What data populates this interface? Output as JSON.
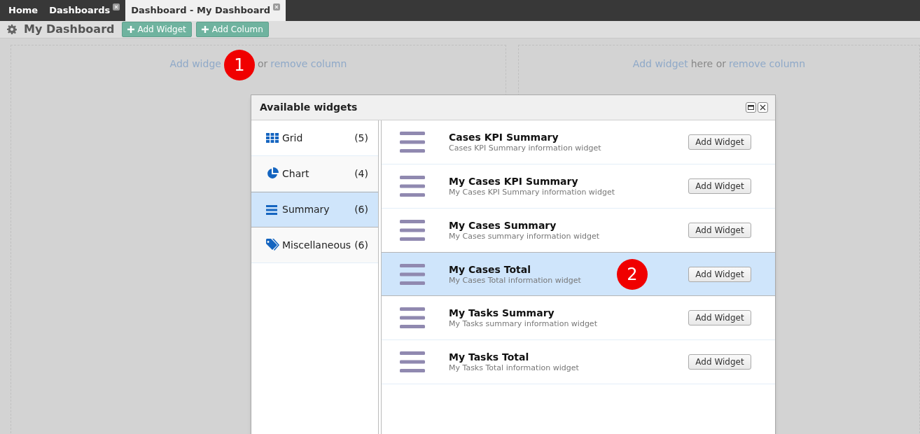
{
  "tabs": [
    {
      "label": "Home",
      "selected": false,
      "closable": false
    },
    {
      "label": "Dashboards",
      "selected": false,
      "closable": true
    },
    {
      "label": "Dashboard - My Dashboard",
      "selected": true,
      "closable": true
    }
  ],
  "toolbar": {
    "title": "My Dashboard",
    "buttons": [
      "Add Widget",
      "Add Column"
    ]
  },
  "columns": [
    {
      "segments": [
        {
          "kind": "link",
          "text": "Add widge"
        },
        {
          "kind": "callout",
          "text": "1"
        },
        {
          "kind": "text",
          "text": "or"
        },
        {
          "kind": "link",
          "text": "remove column"
        }
      ]
    },
    {
      "segments": [
        {
          "kind": "link",
          "text": "Add widget"
        },
        {
          "kind": "text",
          "text": "here or"
        },
        {
          "kind": "link",
          "text": "remove column"
        }
      ]
    }
  ],
  "dialog": {
    "title": "Available widgets",
    "categories": [
      {
        "kind": "grid",
        "label": "Grid",
        "count": "(5)",
        "selected": false
      },
      {
        "kind": "chart",
        "label": "Chart",
        "count": "(4)",
        "selected": false
      },
      {
        "kind": "summary",
        "label": "Summary",
        "count": "(6)",
        "selected": true
      },
      {
        "kind": "tag",
        "label": "Miscellaneous",
        "count": "(6)",
        "selected": false
      }
    ],
    "widgets": [
      {
        "title": "Cases KPI Summary",
        "description": "Cases KPI Summary information widget",
        "button": "Add Widget",
        "selected": false
      },
      {
        "title": "My Cases KPI Summary",
        "description": "My Cases KPI Summary information widget",
        "button": "Add Widget",
        "selected": false
      },
      {
        "title": "My Cases Summary",
        "description": "My Cases summary information widget",
        "button": "Add Widget",
        "selected": false
      },
      {
        "title": "My Cases Total",
        "description": "My Cases Total information widget",
        "button": "Add Widget",
        "selected": true,
        "callout": "2"
      },
      {
        "title": "My Tasks Summary",
        "description": "My Tasks summary information widget",
        "button": "Add Widget",
        "selected": false
      },
      {
        "title": "My Tasks Total",
        "description": "My Tasks Total information widget",
        "button": "Add Widget",
        "selected": false
      }
    ]
  }
}
